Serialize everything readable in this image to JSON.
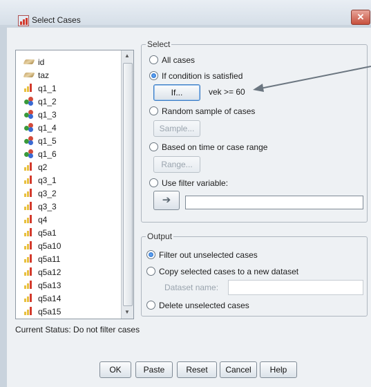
{
  "window": {
    "title": "Select Cases",
    "close_label": "✕"
  },
  "variables": [
    {
      "name": "id",
      "type": "ruler"
    },
    {
      "name": "taz",
      "type": "ruler"
    },
    {
      "name": "q1_1",
      "type": "bars"
    },
    {
      "name": "q1_2",
      "type": "nom"
    },
    {
      "name": "q1_3",
      "type": "nom"
    },
    {
      "name": "q1_4",
      "type": "nom"
    },
    {
      "name": "q1_5",
      "type": "nom"
    },
    {
      "name": "q1_6",
      "type": "nom"
    },
    {
      "name": "q2",
      "type": "bars"
    },
    {
      "name": "q3_1",
      "type": "bars"
    },
    {
      "name": "q3_2",
      "type": "bars"
    },
    {
      "name": "q3_3",
      "type": "bars"
    },
    {
      "name": "q4",
      "type": "bars"
    },
    {
      "name": "q5a1",
      "type": "bars"
    },
    {
      "name": "q5a10",
      "type": "bars"
    },
    {
      "name": "q5a11",
      "type": "bars"
    },
    {
      "name": "q5a12",
      "type": "bars"
    },
    {
      "name": "q5a13",
      "type": "bars"
    },
    {
      "name": "q5a14",
      "type": "bars"
    },
    {
      "name": "q5a15",
      "type": "bars"
    }
  ],
  "select": {
    "label": "Select",
    "all_cases": "All cases",
    "if_condition": "If condition is satisfied",
    "if_button": "If...",
    "condition_text": "vek >= 60",
    "random_sample": "Random sample of cases",
    "sample_button": "Sample...",
    "based_on_time": "Based on time or case range",
    "range_button": "Range...",
    "use_filter": "Use filter variable:",
    "filter_value": ""
  },
  "output": {
    "label": "Output",
    "filter_out": "Filter out unselected cases",
    "copy_selected": "Copy selected cases to a new dataset",
    "dataset_name_label": "Dataset name:",
    "dataset_name_value": "",
    "delete_unselected": "Delete unselected cases"
  },
  "status": {
    "text": "Current Status: Do not filter cases"
  },
  "buttons": {
    "ok": "OK",
    "paste": "Paste",
    "reset": "Reset",
    "cancel": "Cancel",
    "help": "Help"
  },
  "colors": {
    "selected_radio": "#1c5fb8",
    "close_button": "#c7503d",
    "annotation_arrow": "#6b7680"
  }
}
